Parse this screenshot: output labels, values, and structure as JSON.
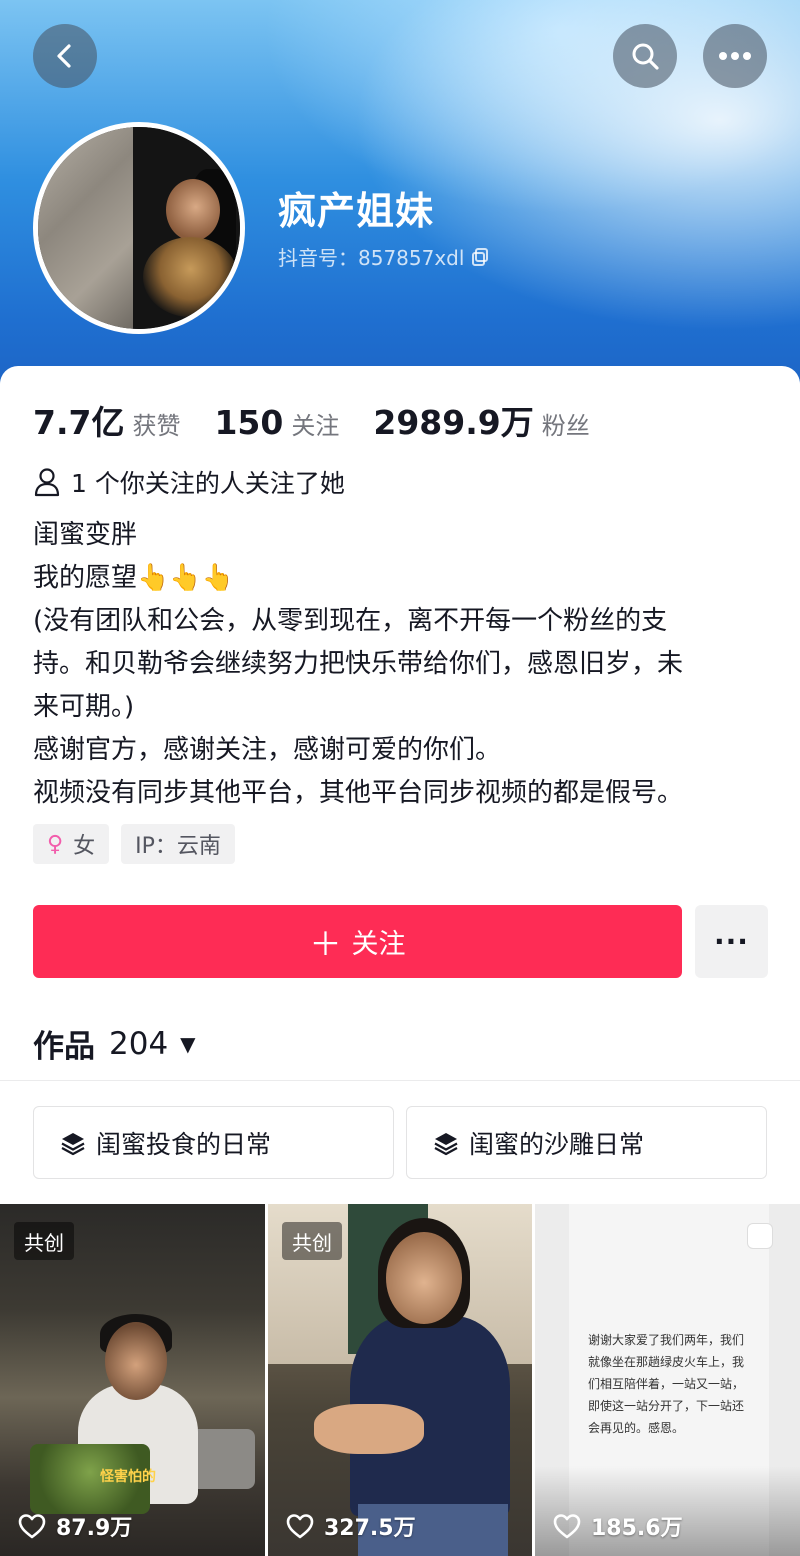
{
  "header": {
    "username": "疯产姐妹",
    "douyin_id": "抖音号：857857xdl",
    "icons": {
      "back": "chevron-left-icon",
      "search": "search-icon",
      "more": "more-horizontal-icon",
      "copy": "copy-icon"
    }
  },
  "stats": [
    {
      "value": "7.7亿",
      "label": "获赞"
    },
    {
      "value": "150",
      "label": "关注"
    },
    {
      "value": "2989.9万",
      "label": "粉丝"
    }
  ],
  "mutual_follow": "1 个你关注的人关注了她",
  "bio": [
    "闺蜜变胖",
    "我的愿望👆👆👆",
    "(没有团队和公会，从零到现在，离不开每一个粉丝的支",
    "持。和贝勒爷会继续努力把快乐带给你们，感恩旧岁，未",
    "来可期。)",
    "感谢官方，感谢关注，感谢可爱的你们。",
    "视频没有同步其他平台，其他平台同步视频的都是假号。"
  ],
  "tags": {
    "gender": "女",
    "ip": "IP：云南"
  },
  "actions": {
    "follow_label": "关注",
    "follow_color": "#fe2c55",
    "more_label": "···"
  },
  "works": {
    "label": "作品",
    "count": "204"
  },
  "playlists": [
    {
      "title": "闺蜜投食的日常"
    },
    {
      "title": "闺蜜的沙雕日常"
    }
  ],
  "videos": [
    {
      "badge": "共创",
      "likes": "87.9万",
      "caption": "怪害怕的"
    },
    {
      "badge": "共创",
      "likes": "327.5万"
    },
    {
      "likes": "185.6万",
      "text": "谢谢大家爱了我们两年，我们就像坐在那趟绿皮火车上，我们相互陪伴着，一站又一站，即使这一站分开了，下一站还会再见的。感恩。"
    }
  ]
}
